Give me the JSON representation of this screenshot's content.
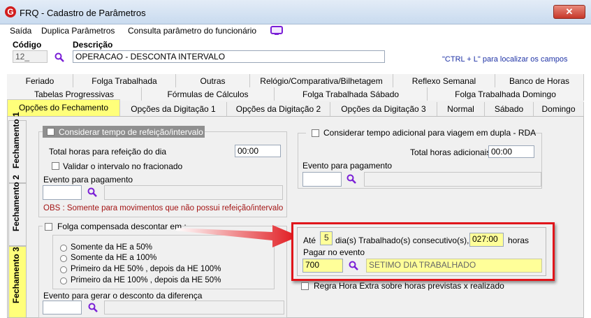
{
  "window": {
    "title": "FRQ - Cadastro de Parâmetros",
    "close_symbol": "✕",
    "logo_letter": "G"
  },
  "menu": {
    "items": [
      "Saída",
      "Duplica Parâmetros",
      "Consulta parâmetro do funcionário"
    ]
  },
  "form": {
    "codigo_label": "Código",
    "codigo_value": "12_",
    "descricao_label": "Descrição",
    "descricao_value": "OPERACAO -  DESCONTA INTERVALO",
    "hint": "\"CTRL + L\" para localizar os campos"
  },
  "tabs": {
    "row1": [
      "Feriado",
      "Folga Trabalhada",
      "Outras",
      "Relógio/Comparativa/Bilhetagem",
      "Reflexo Semanal",
      "Banco de Horas"
    ],
    "row2": [
      "Tabelas Progressivas",
      "Fórmulas de Cálculos",
      "Folga Trabalhada Sábado",
      "Folga Trabalhada Domingo"
    ],
    "row3": [
      "Opções do Fechamento",
      "Opções da Digitação 1",
      "Opções da Digitação 2",
      "Opções da Digitação 3",
      "Normal",
      "Sábado",
      "Domingo"
    ]
  },
  "vtabs": [
    "Fechamento 1",
    "Fechamento 2",
    "Fechamento 3"
  ],
  "left_group1": {
    "title": "Considerar tempo de refeição/intervalo",
    "total_label": "Total horas para refeição do dia",
    "total_value": "00:00",
    "validar_label": "Validar o intervalo no fracionado",
    "evento_label": "Evento para pagamento",
    "obs": "OBS : Somente para movimentos que não possui refeição/intervalo"
  },
  "right_group1": {
    "title": "Considerar tempo adicional para viagem em dupla - RDA",
    "total_label": "Total horas adicionais",
    "total_value": "00:00",
    "evento_label": "Evento para pagamento"
  },
  "left_group2": {
    "title": "Folga compensada descontar em :",
    "options": [
      "Somente da HE a 50%",
      "Somente da HE a 100%",
      "Primeiro da HE 50% , depois da HE 100%",
      "Primeiro da HE 100% , depois da HE 50%"
    ],
    "evento_label": "Evento para gerar o desconto da diferença"
  },
  "highlight": {
    "ate_label": "Até",
    "dias_value": "5",
    "dias_label": "dia(s) Trabalhado(s) consecutivo(s),",
    "horas_value": "027:00",
    "horas_label": "horas",
    "pagar_label": "Pagar no evento",
    "evento_code": "700",
    "evento_desc": "SETIMO DIA TRABALHADO"
  },
  "regra_label": "Regra Hora Extra sobre horas previstas x realizado",
  "icons": [
    "magnifier-icon",
    "monitor-icon",
    "arrow-icon"
  ],
  "colors": {
    "highlight_border": "#e0161b",
    "tab_active": "#ffff7a",
    "purple": "#7a1fd6",
    "obs_red": "#a31515"
  }
}
